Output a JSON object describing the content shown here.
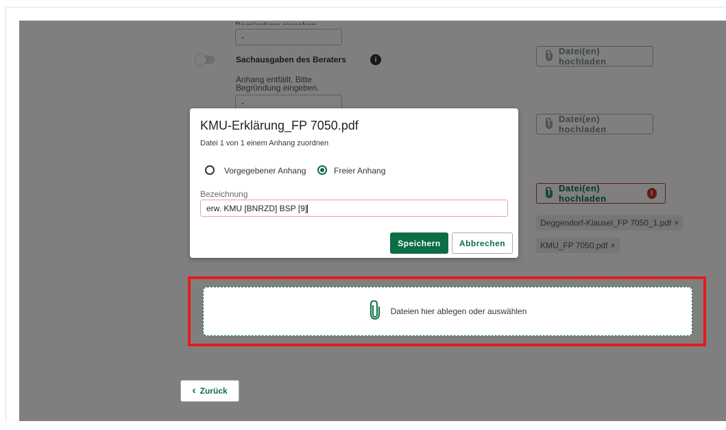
{
  "background": {
    "top_partial_label": "Begründung eingeben.",
    "top_input_value": "-",
    "row_label": "Sachausgaben des Beraters",
    "note_text_line1": "Anhang entfällt. Bitte",
    "note_text_line2": "Begründung eingeben.",
    "note_input_value": "-",
    "upload_label": "Datei(en) hochladen",
    "files": [
      "Deggendorf-Klausel_FP 7050_1.pdf",
      "KMU_FP 7050.pdf"
    ],
    "chip_close": "×",
    "error_symbol": "!",
    "info_symbol": "i"
  },
  "dropzone": {
    "text": "Dateien hier ablegen oder auswählen"
  },
  "back_button": {
    "chevron": "‹",
    "label": "Zurück"
  },
  "modal": {
    "title": "KMU-Erklärung_FP 7050.pdf",
    "subtitle": "Datei 1 von 1 einem Anhang zuordnen",
    "radio_options": [
      "Vorgegebener Anhang",
      "Freier Anhang"
    ],
    "selected_option": "Freier Anhang",
    "field_label": "Bezeichnung",
    "field_value": "erw. KMU [BNRZD] BSP [9]",
    "save_label": "Speichern",
    "cancel_label": "Abbrechen"
  },
  "colors": {
    "primary": "#0b6e45",
    "error": "#c0392b",
    "highlight": "#e51b1b"
  }
}
